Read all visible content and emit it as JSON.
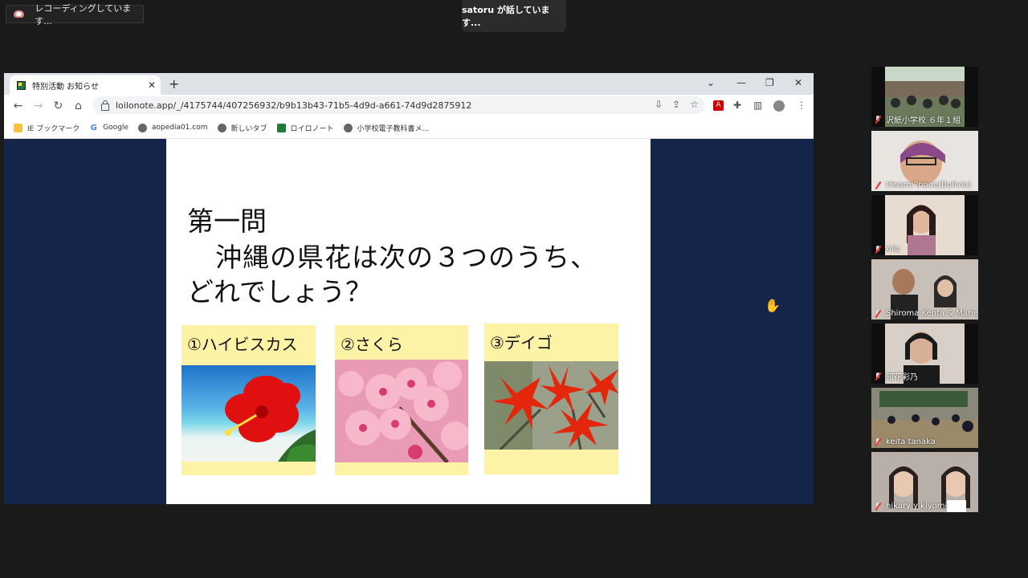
{
  "recording": {
    "text": "レコーディングしています..."
  },
  "speaking": {
    "text": "satoru が話しています..."
  },
  "browser": {
    "tab_title": "特別活動 お知らせ",
    "url": "loilonote.app/_/4175744/407256932/b9b13b43-71b5-4d9d-a661-74d9d2875912",
    "bookmarks": [
      "IE ブックマーク",
      "Google",
      "aopedia01.com",
      "新しいタブ",
      "ロイロノート",
      "小学校電子教科書メ..."
    ]
  },
  "slide": {
    "line1": "第一問",
    "line2": "沖縄の県花は次の３つのうち、",
    "line3": "どれでしょう？",
    "options": [
      {
        "label": "①ハイビスカス"
      },
      {
        "label": "②さくら"
      },
      {
        "label": "③デイゴ"
      }
    ]
  },
  "participants": [
    {
      "name": "沢紙小学校 ６年１組"
    },
    {
      "name": "Hisami Inoue(Bolivia)"
    },
    {
      "name": "Aliz"
    },
    {
      "name": "Shiroma Kenta & Marie"
    },
    {
      "name": "知花彩乃"
    },
    {
      "name": "keita tanaka"
    },
    {
      "name": "hikary y kiyomi"
    }
  ]
}
